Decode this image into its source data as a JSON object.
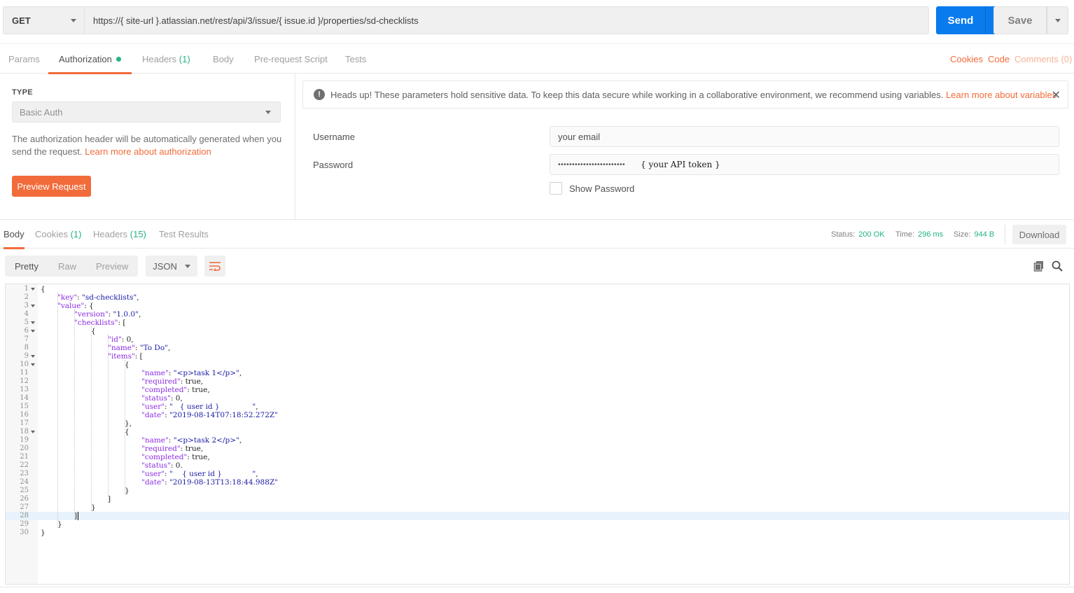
{
  "request": {
    "method": "GET",
    "url": "https://{ site-url }.atlassian.net/rest/api/3/issue/{ issue.id }/properties/sd-checklists",
    "send_label": "Send",
    "save_label": "Save"
  },
  "req_tabs": {
    "params": "Params",
    "authorization": "Authorization",
    "headers": "Headers",
    "headers_count": "(1)",
    "body": "Body",
    "prerequest": "Pre-request Script",
    "tests": "Tests",
    "cookies": "Cookies",
    "code": "Code",
    "comments": "Comments (0)"
  },
  "auth": {
    "type_label": "TYPE",
    "type_value": "Basic Auth",
    "description": "The authorization header will be automatically generated when you send the request.",
    "learn_more": "Learn more about authorization",
    "preview_button": "Preview Request",
    "banner_text": "Heads up! These parameters hold sensitive data. To keep this data secure while working in a collaborative environment, we recommend using variables.",
    "banner_link": "Learn more about variables",
    "username_label": "Username",
    "username_value": "your email",
    "password_label": "Password",
    "password_dots": "••••••••••••••••••••••••",
    "password_note": "{ your API token }",
    "show_password": "Show Password"
  },
  "response": {
    "tabs": {
      "body": "Body",
      "cookies": "Cookies",
      "cookies_count": "(1)",
      "headers": "Headers",
      "headers_count": "(15)",
      "test_results": "Test Results"
    },
    "status_label": "Status:",
    "status_value": "200 OK",
    "time_label": "Time:",
    "time_value": "296 ms",
    "size_label": "Size:",
    "size_value": "944 B",
    "download": "Download",
    "format": {
      "pretty": "Pretty",
      "raw": "Raw",
      "preview": "Preview",
      "json": "JSON"
    }
  },
  "icons": {
    "method_caret": "chevron-down-icon",
    "send_caret": "chevron-down-icon",
    "save_caret": "chevron-down-icon",
    "warning": "exclamation-circle-icon",
    "close": "close-icon",
    "wrap": "wrap-lines-icon",
    "copy": "copy-icon",
    "search": "search-icon"
  },
  "colors": {
    "accent": "#f26b3a",
    "send": "#097bed",
    "success": "#26b47f"
  }
}
